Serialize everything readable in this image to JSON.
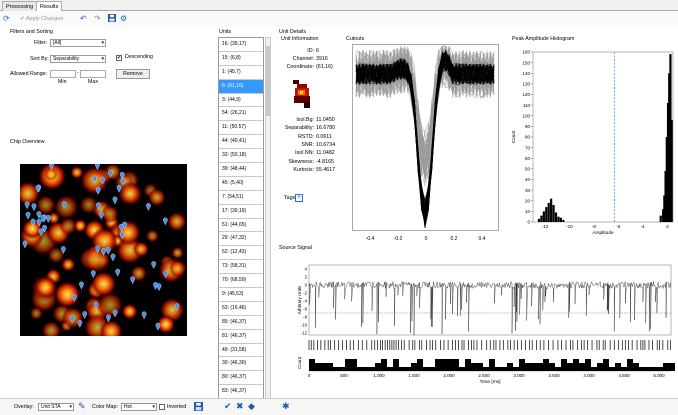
{
  "tabs": [
    {
      "label": "Processing"
    },
    {
      "label": "Results"
    }
  ],
  "toolbar": {
    "apply_label": "Apply Changes"
  },
  "filters": {
    "title": "Filters and Sorting",
    "filter_label": "Filter:",
    "filter_value": "[All]",
    "sortby_label": "Sort By:",
    "sortby_value": "Separability",
    "descending_label": "Descending",
    "descending_checked": "✔",
    "range_label": "Allowed Range:",
    "min_label": "Min",
    "max_label": "Max",
    "remove_label": "Remove"
  },
  "chip": {
    "title": "Chip Overview"
  },
  "units": {
    "title": "Units",
    "items": [
      "16: (39,17)",
      "15: (6,8)",
      "1: (45,7)",
      "6: (61,16)",
      "3: (44,9)",
      "54: (26,21)",
      "11: (50,57)",
      "44: (40,41)",
      "33: (50,18)",
      "39: (48,44)",
      "45: (5,40)",
      "7: (54,51)",
      "17: (39,19)",
      "51: (44,65)",
      "29: (47,32)",
      "62: (12,43)",
      "73: (58,31)",
      "70: (68,59)",
      "9: (45,53)",
      "63: (16,46)",
      "85: (46,37)",
      "81: (46,37)",
      "49: (31,58)",
      "30: (46,30)",
      "80: (46,37)",
      "83: (46,37)",
      "82: (45,27)"
    ],
    "selected_index": 3
  },
  "details": {
    "title": "Unit Details",
    "info_title": "Unit Information",
    "id_label": "ID:",
    "id_value": "6",
    "channel_label": "Channel:",
    "channel_value": "3916",
    "coord_label": "Coordinate:",
    "coord_value": "(61,16)",
    "stats": [
      {
        "label": "Isol.Bg:",
        "value": "11.0450"
      },
      {
        "label": "Separability:",
        "value": "16.6780"
      },
      {
        "label": "RSTD:",
        "value": "0.0611"
      },
      {
        "label": "SNR:",
        "value": "10.6734"
      },
      {
        "label": "Isol.NN:",
        "value": "11.0482"
      },
      {
        "label": "Skewness:",
        "value": "-4.8165"
      },
      {
        "label": "Kurtosis:",
        "value": "55.4617"
      }
    ],
    "tags_label": "Tags"
  },
  "cutouts": {
    "title": "Cutouts",
    "xticks": [
      "-0.4",
      "-0.2",
      "0",
      "0.2",
      "0.4"
    ]
  },
  "histogram": {
    "title": "Peak Amplitude Histogram",
    "ylabel": "Count",
    "xlabel": "Amplitude",
    "yticks": [
      "0",
      "10",
      "20",
      "30",
      "40",
      "50",
      "60",
      "70",
      "80",
      "90",
      "100",
      "110",
      "120",
      "130",
      "140",
      "150",
      "160"
    ],
    "xticks": [
      "-12",
      "-10",
      "-8",
      "-6",
      "-4",
      "-2"
    ]
  },
  "source": {
    "title": "Source Signal",
    "ylabel": "Arbitrary Units",
    "count_label": "Count",
    "xlabel": "Time [ms]",
    "yticks": [
      "4",
      "2",
      "0",
      "-2",
      "-4",
      "-6",
      "-8",
      "-10",
      "-12"
    ],
    "xticks": [
      "0",
      "500",
      "1.000",
      "1.500",
      "2.000",
      "2.500",
      "3.000",
      "3.500",
      "4.000",
      "4.500",
      "5.000"
    ]
  },
  "bottom": {
    "overlay_label": "Overlay:",
    "overlay_value": "Unit STA",
    "colormap_label": "Color Map:",
    "colormap_value": "Hot",
    "inverted_label": "Inverted"
  },
  "colors": {
    "accent": "#3399ff",
    "heat_bright": "#ffdd44",
    "heat_mid": "#e03010",
    "marker": "#4a90e2",
    "threshold": "#1e90ff"
  }
}
